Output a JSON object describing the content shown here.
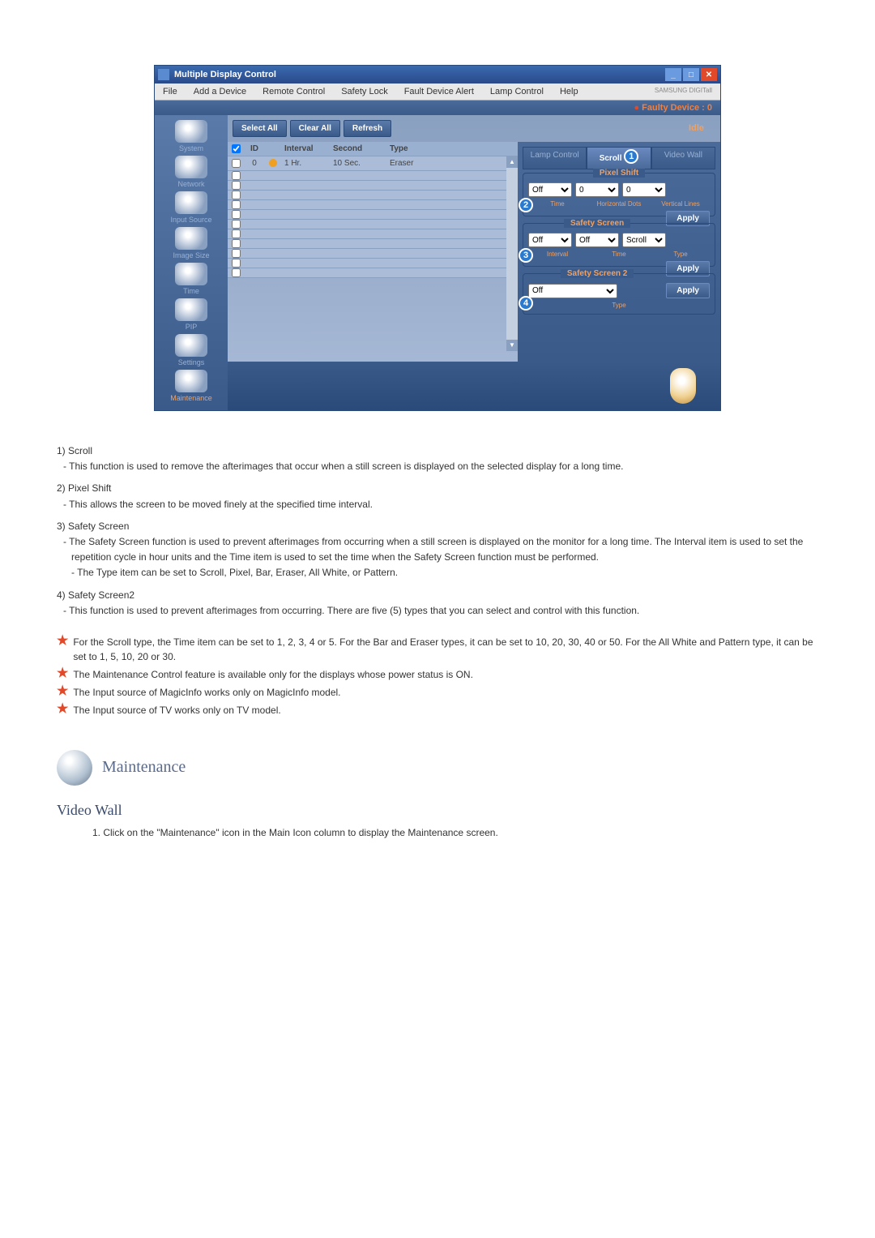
{
  "window": {
    "title": "Multiple Display Control",
    "menu": [
      "File",
      "Add a Device",
      "Remote Control",
      "Safety Lock",
      "Fault Device Alert",
      "Lamp Control",
      "Help"
    ],
    "brand": "SAMSUNG DIGITall",
    "faulty": "Faulty Device : 0",
    "idle": "Idle"
  },
  "sidebar": [
    {
      "label": "System"
    },
    {
      "label": "Network"
    },
    {
      "label": "Input Source"
    },
    {
      "label": "Image Size"
    },
    {
      "label": "Time"
    },
    {
      "label": "PIP"
    },
    {
      "label": "Settings"
    },
    {
      "label": "Maintenance"
    }
  ],
  "toolbar": {
    "select_all": "Select All",
    "clear_all": "Clear All",
    "refresh": "Refresh"
  },
  "grid": {
    "headers": {
      "id": "ID",
      "interval": "Interval",
      "second": "Second",
      "type": "Type"
    },
    "row": {
      "id": "0",
      "interval": "1  Hr.",
      "second": "10 Sec.",
      "type": "Eraser"
    }
  },
  "rtabs": {
    "t1": "Lamp Control",
    "t2": "Scroll",
    "t3": "Video Wall"
  },
  "callouts": {
    "c1": "1",
    "c2": "2",
    "c3": "3",
    "c4": "4"
  },
  "ps": {
    "title": "Pixel Shift",
    "off": "Off",
    "hd": "0",
    "vl": "0",
    "sub_time": "Time",
    "sub_hd": "Horizontal Dots",
    "sub_vl": "Vertical Lines",
    "apply": "Apply"
  },
  "ss": {
    "title": "Safety Screen",
    "off1": "Off",
    "off2": "Off",
    "scroll": "Scroll",
    "sub_int": "Interval",
    "sub_time": "Time",
    "sub_type": "Type",
    "apply": "Apply"
  },
  "ss2": {
    "title": "Safety Screen 2",
    "off": "Off",
    "sub_type": "Type",
    "apply": "Apply"
  },
  "explain": {
    "n1": "1) Scroll",
    "d1": "This function is used to remove the afterimages that occur when a still screen is displayed on the selected display for a long time.",
    "n2": "2) Pixel Shift",
    "d2": "This allows the screen to be moved finely at the specified time interval.",
    "n3": "3) Safety Screen",
    "d3a": "The Safety Screen function is used to prevent afterimages from occurring when a still screen is displayed on the monitor for a long time.  The Interval item is used to set the repetition cycle in hour units and the Time item is used to set the time when the Safety Screen function must be performed.",
    "d3b": "The Type item can be set to Scroll, Pixel, Bar, Eraser, All White, or Pattern.",
    "n4": "4) Safety Screen2",
    "d4": "This function is used to prevent afterimages from occurring. There are five (5) types that you can select and control with this function.",
    "note1": "For the Scroll type, the Time item can be set to 1, 2, 3, 4 or 5. For the Bar and Eraser types, it can be set to 10, 20, 30, 40 or 50. For the All White and Pattern type, it can be set to 1, 5, 10, 20 or 30.",
    "note2": "The Maintenance Control feature is available only for the displays whose power status is ON.",
    "note3": "The Input source of MagicInfo works only on MagicInfo model.",
    "note4": "The Input source of TV works only on TV model."
  },
  "maint": {
    "heading": "Maintenance",
    "subhead": "Video Wall",
    "step1": "1. Click on the \"Maintenance\" icon in the Main Icon column to display the Maintenance screen."
  }
}
